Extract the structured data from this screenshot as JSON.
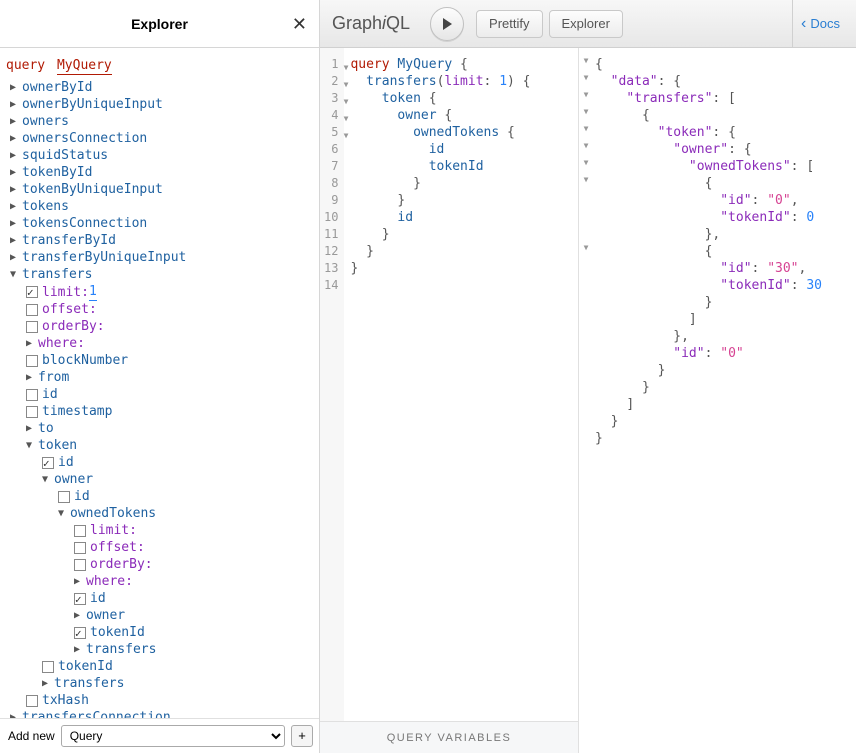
{
  "explorer": {
    "title": "Explorer",
    "op_keyword": "query",
    "op_name": "MyQuery",
    "add_new_label": "Add new",
    "add_new_selected": "Query",
    "plus_label": "+",
    "root_fields": [
      "ownerById",
      "ownerByUniqueInput",
      "owners",
      "ownersConnection",
      "squidStatus",
      "tokenById",
      "tokenByUniqueInput",
      "tokens",
      "tokensConnection",
      "transferById",
      "transferByUniqueInput"
    ],
    "transfers_label": "transfers",
    "transfers": {
      "arg_limit_name": "limit:",
      "arg_limit_value": "1",
      "arg_offset": "offset:",
      "arg_orderBy": "orderBy:",
      "arg_where": "where:",
      "f_blockNumber": "blockNumber",
      "f_from": "from",
      "f_id": "id",
      "f_timestamp": "timestamp",
      "f_to": "to",
      "f_token": "token",
      "token": {
        "f_id": "id",
        "f_owner": "owner",
        "owner": {
          "f_id": "id",
          "f_ownedTokens": "ownedTokens",
          "ownedTokens": {
            "arg_limit": "limit:",
            "arg_offset": "offset:",
            "arg_orderBy": "orderBy:",
            "arg_where": "where:",
            "f_id": "id",
            "f_owner": "owner",
            "f_tokenId": "tokenId",
            "f_transfers": "transfers"
          }
        },
        "f_tokenId": "tokenId",
        "f_transfers": "transfers"
      },
      "f_txHash": "txHash"
    },
    "transfersConnection_label": "transfersConnection"
  },
  "topbar": {
    "logo_pre": "Graph",
    "logo_i": "i",
    "logo_post": "QL",
    "prettify": "Prettify",
    "explorer": "Explorer",
    "docs": "Docs"
  },
  "query": {
    "line_count": 14,
    "l1a": "query ",
    "l1b": "MyQuery ",
    "l1c": "{",
    "l2a": "  ",
    "l2b": "transfers",
    "l2c": "(",
    "l2d": "limit",
    "l2e": ": ",
    "l2f": "1",
    "l2g": ") {",
    "l3a": "    ",
    "l3b": "token ",
    "l3c": "{",
    "l4a": "      ",
    "l4b": "owner ",
    "l4c": "{",
    "l5a": "        ",
    "l5b": "ownedTokens ",
    "l5c": "{",
    "l6a": "          ",
    "l6b": "id",
    "l7a": "          ",
    "l7b": "tokenId",
    "l8": "        }",
    "l9": "      }",
    "l10a": "      ",
    "l10b": "id",
    "l11": "    }",
    "l12": "  }",
    "l13": "}",
    "vars_label": "QUERY VARIABLES"
  },
  "result": {
    "k_data": "\"data\"",
    "k_transfers": "\"transfers\"",
    "k_token": "\"token\"",
    "k_owner": "\"owner\"",
    "k_ownedTokens": "\"ownedTokens\"",
    "k_id": "\"id\"",
    "k_tokenId": "\"tokenId\"",
    "v_0s": "\"0\"",
    "v_0n": "0",
    "v_30s": "\"30\"",
    "v_30n": "30"
  }
}
